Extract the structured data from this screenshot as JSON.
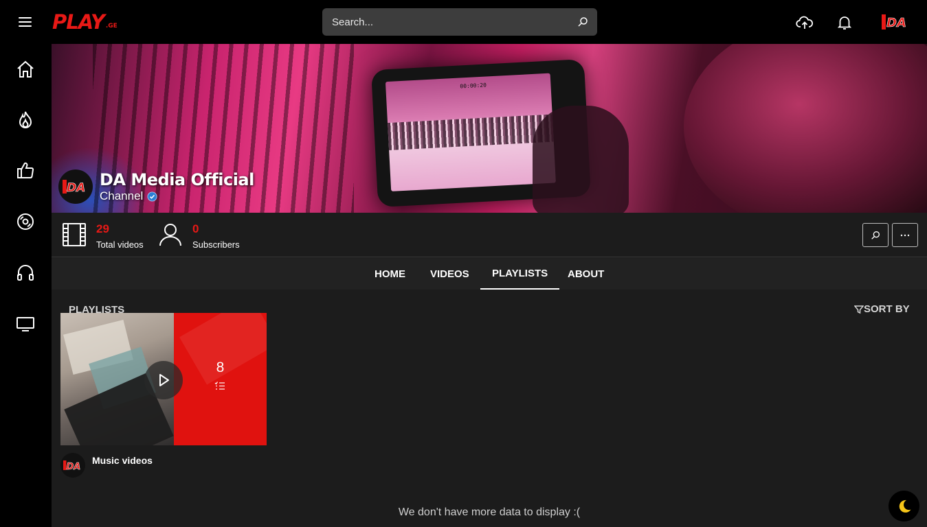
{
  "header": {
    "logo_text": "PLAY",
    "logo_suffix": ".GE",
    "search_placeholder": "Search..."
  },
  "sidebar": {
    "items": [
      {
        "icon": "home-icon"
      },
      {
        "icon": "trending-fire-icon"
      },
      {
        "icon": "thumbs-up-icon"
      },
      {
        "icon": "disc-icon"
      },
      {
        "icon": "headphones-icon"
      },
      {
        "icon": "tv-icon"
      }
    ]
  },
  "channel": {
    "name": "DA Media Official",
    "type": "Channel",
    "avatar_text": "DA",
    "video_timestamp": "00:00:20"
  },
  "stats": {
    "total_videos": "29",
    "total_videos_label": "Total videos",
    "subscribers": "0",
    "subscribers_label": "Subscribers"
  },
  "tabs": [
    {
      "label": "HOME"
    },
    {
      "label": "VIDEOS"
    },
    {
      "label": "PLAYLISTS",
      "active": true
    },
    {
      "label": "ABOUT"
    }
  ],
  "playlists": {
    "section_title": "PLAYLISTS",
    "sort_label": "SORT BY",
    "items": [
      {
        "title": "Music videos",
        "count": "8"
      }
    ]
  },
  "footer": {
    "no_more": "We don't have more data to display :("
  },
  "colors": {
    "brand_red": "#e81916",
    "background": "#1c1c1c",
    "sidebar": "#000000"
  }
}
